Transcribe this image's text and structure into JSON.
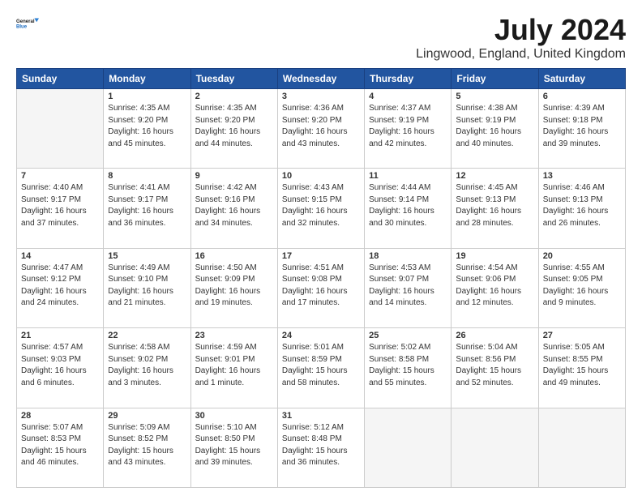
{
  "header": {
    "logo_line1": "General",
    "logo_line2": "Blue",
    "title": "July 2024",
    "subtitle": "Lingwood, England, United Kingdom"
  },
  "weekdays": [
    "Sunday",
    "Monday",
    "Tuesday",
    "Wednesday",
    "Thursday",
    "Friday",
    "Saturday"
  ],
  "weeks": [
    [
      {
        "day": "",
        "empty": true
      },
      {
        "day": "1",
        "sunrise": "4:35 AM",
        "sunset": "9:20 PM",
        "daylight": "16 hours and 45 minutes."
      },
      {
        "day": "2",
        "sunrise": "4:35 AM",
        "sunset": "9:20 PM",
        "daylight": "16 hours and 44 minutes."
      },
      {
        "day": "3",
        "sunrise": "4:36 AM",
        "sunset": "9:20 PM",
        "daylight": "16 hours and 43 minutes."
      },
      {
        "day": "4",
        "sunrise": "4:37 AM",
        "sunset": "9:19 PM",
        "daylight": "16 hours and 42 minutes."
      },
      {
        "day": "5",
        "sunrise": "4:38 AM",
        "sunset": "9:19 PM",
        "daylight": "16 hours and 40 minutes."
      },
      {
        "day": "6",
        "sunrise": "4:39 AM",
        "sunset": "9:18 PM",
        "daylight": "16 hours and 39 minutes."
      }
    ],
    [
      {
        "day": "7",
        "sunrise": "4:40 AM",
        "sunset": "9:17 PM",
        "daylight": "16 hours and 37 minutes."
      },
      {
        "day": "8",
        "sunrise": "4:41 AM",
        "sunset": "9:17 PM",
        "daylight": "16 hours and 36 minutes."
      },
      {
        "day": "9",
        "sunrise": "4:42 AM",
        "sunset": "9:16 PM",
        "daylight": "16 hours and 34 minutes."
      },
      {
        "day": "10",
        "sunrise": "4:43 AM",
        "sunset": "9:15 PM",
        "daylight": "16 hours and 32 minutes."
      },
      {
        "day": "11",
        "sunrise": "4:44 AM",
        "sunset": "9:14 PM",
        "daylight": "16 hours and 30 minutes."
      },
      {
        "day": "12",
        "sunrise": "4:45 AM",
        "sunset": "9:13 PM",
        "daylight": "16 hours and 28 minutes."
      },
      {
        "day": "13",
        "sunrise": "4:46 AM",
        "sunset": "9:13 PM",
        "daylight": "16 hours and 26 minutes."
      }
    ],
    [
      {
        "day": "14",
        "sunrise": "4:47 AM",
        "sunset": "9:12 PM",
        "daylight": "16 hours and 24 minutes."
      },
      {
        "day": "15",
        "sunrise": "4:49 AM",
        "sunset": "9:10 PM",
        "daylight": "16 hours and 21 minutes."
      },
      {
        "day": "16",
        "sunrise": "4:50 AM",
        "sunset": "9:09 PM",
        "daylight": "16 hours and 19 minutes."
      },
      {
        "day": "17",
        "sunrise": "4:51 AM",
        "sunset": "9:08 PM",
        "daylight": "16 hours and 17 minutes."
      },
      {
        "day": "18",
        "sunrise": "4:53 AM",
        "sunset": "9:07 PM",
        "daylight": "16 hours and 14 minutes."
      },
      {
        "day": "19",
        "sunrise": "4:54 AM",
        "sunset": "9:06 PM",
        "daylight": "16 hours and 12 minutes."
      },
      {
        "day": "20",
        "sunrise": "4:55 AM",
        "sunset": "9:05 PM",
        "daylight": "16 hours and 9 minutes."
      }
    ],
    [
      {
        "day": "21",
        "sunrise": "4:57 AM",
        "sunset": "9:03 PM",
        "daylight": "16 hours and 6 minutes."
      },
      {
        "day": "22",
        "sunrise": "4:58 AM",
        "sunset": "9:02 PM",
        "daylight": "16 hours and 3 minutes."
      },
      {
        "day": "23",
        "sunrise": "4:59 AM",
        "sunset": "9:01 PM",
        "daylight": "16 hours and 1 minute."
      },
      {
        "day": "24",
        "sunrise": "5:01 AM",
        "sunset": "8:59 PM",
        "daylight": "15 hours and 58 minutes."
      },
      {
        "day": "25",
        "sunrise": "5:02 AM",
        "sunset": "8:58 PM",
        "daylight": "15 hours and 55 minutes."
      },
      {
        "day": "26",
        "sunrise": "5:04 AM",
        "sunset": "8:56 PM",
        "daylight": "15 hours and 52 minutes."
      },
      {
        "day": "27",
        "sunrise": "5:05 AM",
        "sunset": "8:55 PM",
        "daylight": "15 hours and 49 minutes."
      }
    ],
    [
      {
        "day": "28",
        "sunrise": "5:07 AM",
        "sunset": "8:53 PM",
        "daylight": "15 hours and 46 minutes."
      },
      {
        "day": "29",
        "sunrise": "5:09 AM",
        "sunset": "8:52 PM",
        "daylight": "15 hours and 43 minutes."
      },
      {
        "day": "30",
        "sunrise": "5:10 AM",
        "sunset": "8:50 PM",
        "daylight": "15 hours and 39 minutes."
      },
      {
        "day": "31",
        "sunrise": "5:12 AM",
        "sunset": "8:48 PM",
        "daylight": "15 hours and 36 minutes."
      },
      {
        "day": "",
        "empty": true
      },
      {
        "day": "",
        "empty": true
      },
      {
        "day": "",
        "empty": true
      }
    ]
  ]
}
